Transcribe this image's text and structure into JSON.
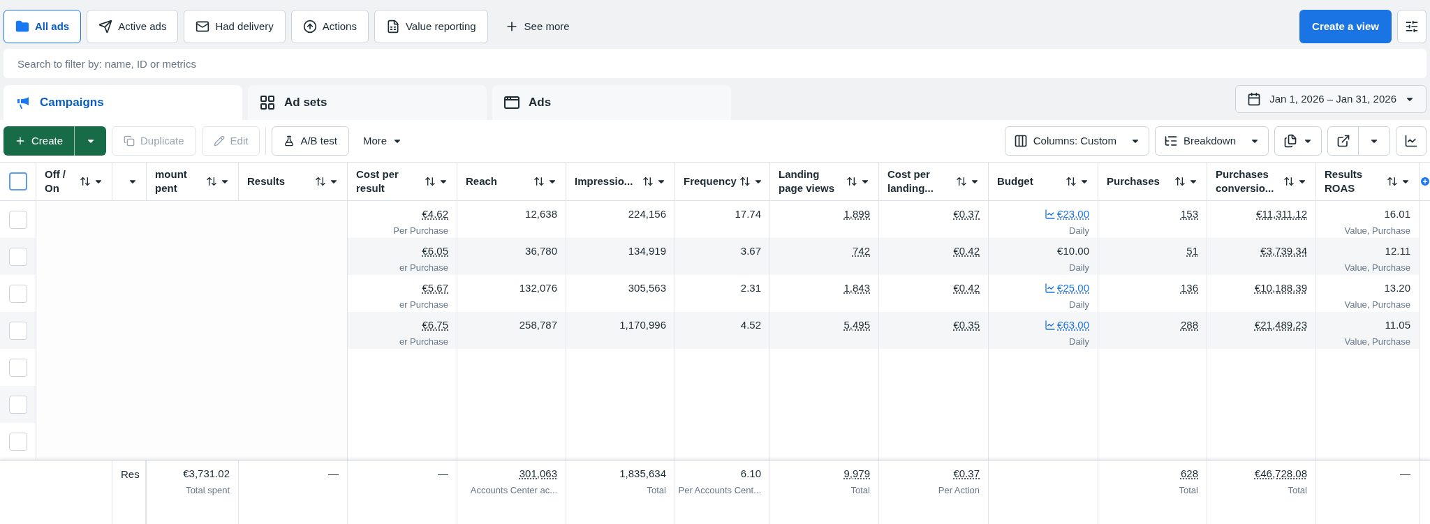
{
  "filters": [
    {
      "label": "All ads",
      "selected": true
    },
    {
      "label": "Active ads",
      "selected": false
    },
    {
      "label": "Had delivery",
      "selected": false
    },
    {
      "label": "Actions",
      "selected": false
    },
    {
      "label": "Value reporting",
      "selected": false
    }
  ],
  "see_more": "See more",
  "create_view": "Create a view",
  "search": {
    "placeholder": "Search to filter by: name, ID or metrics"
  },
  "level_tabs": [
    {
      "label": "Campaigns",
      "selected": true
    },
    {
      "label": "Ad sets",
      "selected": false
    },
    {
      "label": "Ads",
      "selected": false
    }
  ],
  "date_range": "Jan 1, 2026 – Jan 31, 2026",
  "toolbar": {
    "create": "Create",
    "duplicate": {
      "label": "Duplicate",
      "disabled": true
    },
    "edit": {
      "label": "Edit",
      "disabled": true
    },
    "ab_test": "A/B test",
    "more": "More",
    "columns": "Columns: Custom",
    "breakdown": "Breakdown"
  },
  "table": {
    "select_all": {
      "checked": false
    },
    "columns": [
      {
        "label": "Off / On"
      },
      {
        "label": "mount pent"
      },
      {
        "label": "Results"
      },
      {
        "label": "Cost per result"
      },
      {
        "label": "Reach"
      },
      {
        "label": "Impressio..."
      },
      {
        "label": "Frequency"
      },
      {
        "label": "Landing page views"
      },
      {
        "label": "Cost per landing..."
      },
      {
        "label": "Budget"
      },
      {
        "label": "Purchases"
      },
      {
        "label": "Purchases conversio..."
      },
      {
        "label": "Results ROAS"
      }
    ],
    "rows": [
      {
        "checked": false,
        "cells": [
          {
            "value": "€4.62",
            "sub": "Per Purchase",
            "underlined": true,
            "linked": false
          },
          {
            "value": "12,638",
            "underlined": false,
            "linked": false
          },
          {
            "value": "224,156",
            "underlined": false,
            "linked": false
          },
          {
            "value": "17.74",
            "underlined": false,
            "linked": false
          },
          {
            "value": "1,899",
            "underlined": true,
            "linked": false
          },
          {
            "value": "€0.37",
            "underlined": true,
            "linked": false
          },
          {
            "value": "€23.00",
            "sub": "Daily",
            "underlined": true,
            "linked": true
          },
          {
            "value": "153",
            "underlined": true,
            "linked": false
          },
          {
            "value": "€11,311.12",
            "underlined": true,
            "linked": false
          },
          {
            "value": "16.01",
            "sub": "Value, Purchase",
            "underlined": false,
            "linked": false
          }
        ]
      },
      {
        "checked": false,
        "cells": [
          {
            "value": "€6.05",
            "sub": "er Purchase",
            "underlined": true,
            "linked": false
          },
          {
            "value": "36,780",
            "underlined": false,
            "linked": false
          },
          {
            "value": "134,919",
            "underlined": false,
            "linked": false
          },
          {
            "value": "3.67",
            "underlined": false,
            "linked": false
          },
          {
            "value": "742",
            "underlined": true,
            "linked": false
          },
          {
            "value": "€0.42",
            "underlined": true,
            "linked": false
          },
          {
            "value": "€10.00",
            "sub": "Daily",
            "underlined": false,
            "linked": false
          },
          {
            "value": "51",
            "underlined": true,
            "linked": false
          },
          {
            "value": "€3,739.34",
            "underlined": true,
            "linked": false
          },
          {
            "value": "12.11",
            "sub": "Value, Purchase",
            "underlined": false,
            "linked": false
          }
        ]
      },
      {
        "checked": false,
        "cells": [
          {
            "value": "€5.67",
            "sub": "er Purchase",
            "underlined": true,
            "linked": false
          },
          {
            "value": "132,076",
            "underlined": false,
            "linked": false
          },
          {
            "value": "305,563",
            "underlined": false,
            "linked": false
          },
          {
            "value": "2.31",
            "underlined": false,
            "linked": false
          },
          {
            "value": "1,843",
            "underlined": true,
            "linked": false
          },
          {
            "value": "€0.42",
            "underlined": true,
            "linked": false
          },
          {
            "value": "€25.00",
            "sub": "Daily",
            "underlined": true,
            "linked": true
          },
          {
            "value": "136",
            "underlined": true,
            "linked": false
          },
          {
            "value": "€10,188.39",
            "underlined": true,
            "linked": false
          },
          {
            "value": "13.20",
            "sub": "Value, Purchase",
            "underlined": false,
            "linked": false
          }
        ]
      },
      {
        "checked": false,
        "cells": [
          {
            "value": "€6.75",
            "sub": "er Purchase",
            "underlined": true,
            "linked": false
          },
          {
            "value": "258,787",
            "underlined": false,
            "linked": false
          },
          {
            "value": "1,170,996",
            "underlined": false,
            "linked": false
          },
          {
            "value": "4.52",
            "underlined": false,
            "linked": false
          },
          {
            "value": "5,495",
            "underlined": true,
            "linked": false
          },
          {
            "value": "€0.35",
            "underlined": true,
            "linked": false
          },
          {
            "value": "€63.00",
            "sub": "Daily",
            "underlined": true,
            "linked": true
          },
          {
            "value": "288",
            "underlined": true,
            "linked": false
          },
          {
            "value": "€21,489.23",
            "underlined": true,
            "linked": false
          },
          {
            "value": "11.05",
            "sub": "Value, Purchase",
            "underlined": false,
            "linked": false
          }
        ]
      },
      {
        "checked": false
      },
      {
        "checked": false
      },
      {
        "checked": false
      }
    ],
    "totals": {
      "label": "Res",
      "cells": [
        {
          "value": "€3,731.02",
          "sub": "Total spent",
          "underlined": false
        },
        {
          "value": "—",
          "underlined": false
        },
        {
          "value": "—",
          "underlined": false
        },
        {
          "value": "301,063",
          "sub": "Accounts Center ac...",
          "underlined": true
        },
        {
          "value": "1,835,634",
          "sub": "Total",
          "underlined": false
        },
        {
          "value": "6.10",
          "sub": "Per Accounts Cent...",
          "underlined": false
        },
        {
          "value": "9,979",
          "sub": "Total",
          "underlined": true
        },
        {
          "value": "€0.37",
          "sub": "Per Action",
          "underlined": true
        },
        null,
        {
          "value": "628",
          "sub": "Total",
          "underlined": true
        },
        {
          "value": "€46,728.08",
          "sub": "Total",
          "underlined": true
        },
        {
          "value": "—",
          "underlined": false
        }
      ]
    }
  }
}
